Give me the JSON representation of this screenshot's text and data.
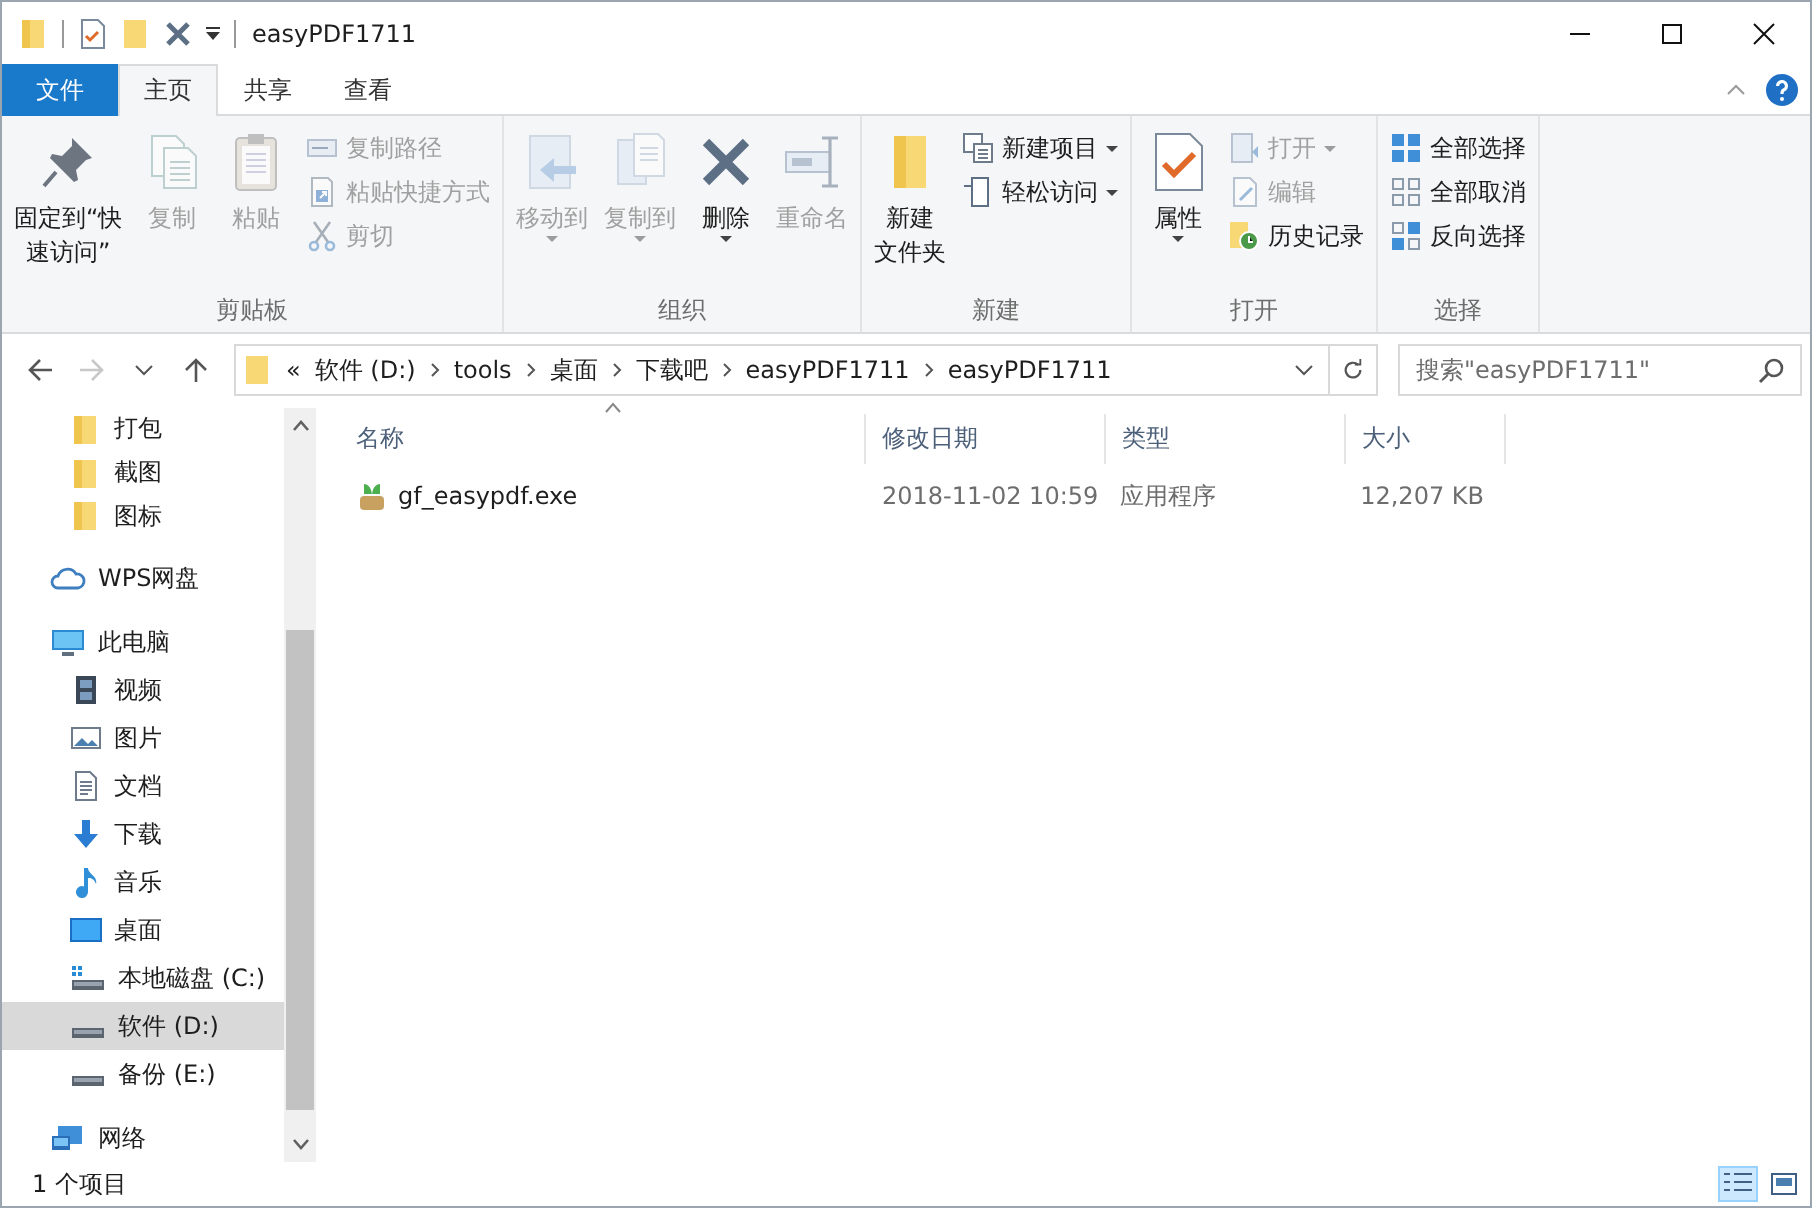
{
  "window": {
    "title": "easyPDF1711"
  },
  "ribbon": {
    "tabs": [
      {
        "label": "文件",
        "kind": "file",
        "selected": false
      },
      {
        "label": "主页",
        "kind": "tab",
        "selected": true
      },
      {
        "label": "共享",
        "kind": "tab",
        "selected": false
      },
      {
        "label": "查看",
        "kind": "tab",
        "selected": false
      }
    ],
    "groups": [
      {
        "label": "剪贴板",
        "items": [
          {
            "kind": "large",
            "label_lines": [
              "固定到“快",
              "速访问”"
            ],
            "disabled": false,
            "dropdown": false
          },
          {
            "kind": "large",
            "label_lines": [
              "复制"
            ],
            "disabled": true,
            "dropdown": false
          },
          {
            "kind": "large",
            "label_lines": [
              "粘贴"
            ],
            "disabled": true,
            "dropdown": false
          },
          {
            "kind": "small",
            "label": "复制路径",
            "disabled": true,
            "dropdown": false
          },
          {
            "kind": "small",
            "label": "粘贴快捷方式",
            "disabled": true,
            "dropdown": false
          },
          {
            "kind": "small",
            "label": "剪切",
            "disabled": true,
            "dropdown": false
          }
        ]
      },
      {
        "label": "组织",
        "items": [
          {
            "kind": "large",
            "label_lines": [
              "移动到"
            ],
            "disabled": true,
            "dropdown": true
          },
          {
            "kind": "large",
            "label_lines": [
              "复制到"
            ],
            "disabled": true,
            "dropdown": true
          },
          {
            "kind": "large",
            "label_lines": [
              "删除"
            ],
            "disabled": false,
            "dropdown": true
          },
          {
            "kind": "large",
            "label_lines": [
              "重命名"
            ],
            "disabled": true,
            "dropdown": false
          }
        ]
      },
      {
        "label": "新建",
        "items": [
          {
            "kind": "large",
            "label_lines": [
              "新建",
              "文件夹"
            ],
            "disabled": false,
            "dropdown": false
          },
          {
            "kind": "small",
            "label": "新建项目",
            "disabled": false,
            "dropdown": true
          },
          {
            "kind": "small",
            "label": "轻松访问",
            "disabled": false,
            "dropdown": true
          }
        ]
      },
      {
        "label": "打开",
        "items": [
          {
            "kind": "large",
            "label_lines": [
              "属性"
            ],
            "disabled": false,
            "dropdown": true
          },
          {
            "kind": "small",
            "label": "打开",
            "disabled": true,
            "dropdown": true
          },
          {
            "kind": "small",
            "label": "编辑",
            "disabled": true,
            "dropdown": false
          },
          {
            "kind": "small",
            "label": "历史记录",
            "disabled": false,
            "dropdown": false
          }
        ]
      },
      {
        "label": "选择",
        "items": [
          {
            "kind": "small",
            "label": "全部选择",
            "disabled": false,
            "dropdown": false
          },
          {
            "kind": "small",
            "label": "全部取消",
            "disabled": false,
            "dropdown": false
          },
          {
            "kind": "small",
            "label": "反向选择",
            "disabled": false,
            "dropdown": false
          }
        ]
      }
    ]
  },
  "address_bar": {
    "overflow": "«",
    "crumbs": [
      "软件 (D:)",
      "tools",
      "桌面",
      "下载吧",
      "easyPDF1711",
      "easyPDF1711"
    ],
    "forward_disabled": true
  },
  "search": {
    "placeholder": "搜索\"easyPDF1711\""
  },
  "sidebar": {
    "pinned_folders": [
      {
        "label": "打包",
        "kind": "folder",
        "selected": false
      },
      {
        "label": "截图",
        "kind": "folder",
        "selected": false
      },
      {
        "label": "图标",
        "kind": "folder",
        "selected": false
      }
    ],
    "items": [
      {
        "label": "WPS网盘",
        "kind": "cloud",
        "selected": false
      },
      {
        "label": "此电脑",
        "kind": "computer",
        "selected": false,
        "children": [
          {
            "label": "视频",
            "kind": "video",
            "selected": false
          },
          {
            "label": "图片",
            "kind": "pictures",
            "selected": false
          },
          {
            "label": "文档",
            "kind": "documents",
            "selected": false
          },
          {
            "label": "下载",
            "kind": "downloads",
            "selected": false
          },
          {
            "label": "音乐",
            "kind": "music",
            "selected": false
          },
          {
            "label": "桌面",
            "kind": "desktop",
            "selected": false
          },
          {
            "label": "本地磁盘 (C:)",
            "kind": "system-drive",
            "selected": false
          },
          {
            "label": "软件 (D:)",
            "kind": "drive",
            "selected": true
          },
          {
            "label": "备份 (E:)",
            "kind": "drive",
            "selected": false
          }
        ]
      },
      {
        "label": "网络",
        "kind": "network",
        "selected": false
      }
    ]
  },
  "file_list": {
    "columns": [
      {
        "label": "名称",
        "sorted": true
      },
      {
        "label": "修改日期",
        "sorted": false
      },
      {
        "label": "类型",
        "sorted": false
      },
      {
        "label": "大小",
        "sorted": false
      }
    ],
    "rows": [
      {
        "cells": [
          "gf_easypdf.exe",
          "2018-11-02 10:59",
          "应用程序",
          "12,207 KB"
        ],
        "selected": false
      }
    ]
  },
  "status_bar": {
    "text": "1 个项目",
    "views": [
      {
        "kind": "details",
        "selected": true
      },
      {
        "kind": "large-icons",
        "selected": false
      }
    ]
  }
}
